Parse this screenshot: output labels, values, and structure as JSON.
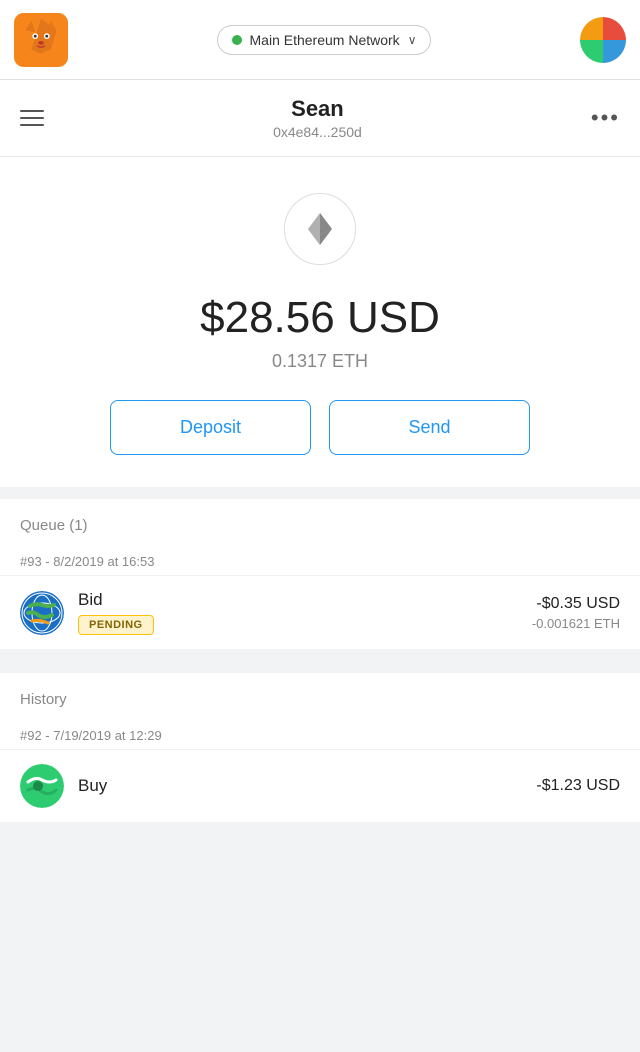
{
  "topNav": {
    "logoAlt": "MetaMask Logo",
    "networkLabel": "Main Ethereum Network",
    "networkDotColor": "#37b24d",
    "chevron": "∨",
    "avatarAlt": "Account Avatar"
  },
  "accountHeader": {
    "hamburgerLabel": "Menu",
    "accountName": "Sean",
    "accountAddress": "0x4e84...250d",
    "moreOptionsLabel": "•••"
  },
  "balanceSection": {
    "ethIconAlt": "Ethereum Icon",
    "usdAmount": "$28.56 USD",
    "ethAmount": "0.1317 ETH",
    "depositLabel": "Deposit",
    "sendLabel": "Send"
  },
  "queueSection": {
    "sectionLabel": "Queue (1)",
    "transaction": {
      "dateHeader": "#93 - 8/2/2019 at 16:53",
      "name": "Bid",
      "badgeLabel": "PENDING",
      "usdAmount": "-$0.35 USD",
      "ethAmount": "-0.001621 ETH"
    }
  },
  "historySection": {
    "sectionLabel": "History",
    "transaction": {
      "dateHeader": "#92 - 7/19/2019 at 12:29",
      "name": "Buy",
      "usdAmount": "-$1.23 USD"
    }
  }
}
